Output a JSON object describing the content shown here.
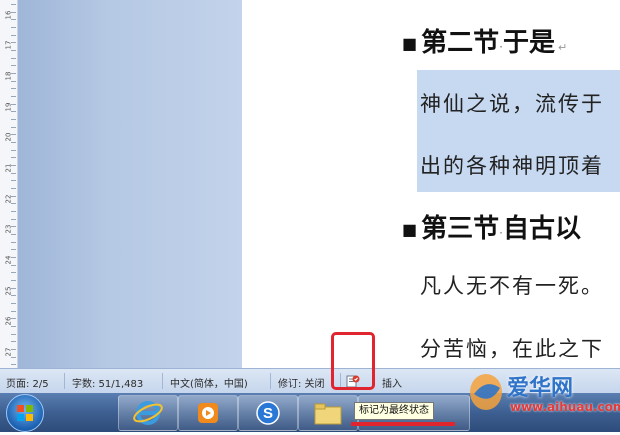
{
  "ruler": {
    "labels": [
      "16",
      "17",
      "18",
      "19",
      "20",
      "21",
      "22",
      "23",
      "24",
      "25",
      "26",
      "27"
    ]
  },
  "document": {
    "heading2": "第二节",
    "heading2_title": "于是",
    "line1": "神仙之说，流传于",
    "line2": "出的各种神明顶着",
    "heading3": "第三节",
    "heading3_title": "自古以",
    "line3": "凡人无不有一死。",
    "line4": "分苦恼，在此之下"
  },
  "statusbar": {
    "page": "页面: 2/5",
    "words": "字数: 51/1,483",
    "language": "中文(简体，中国)",
    "revision": "修订: 关闭",
    "insert": "插入"
  },
  "taskbar": {
    "tooltip": "标记为最终状态"
  },
  "watermark": {
    "text": "爱华网",
    "url": "www.aihuau.com"
  },
  "colors": {
    "annotation_red": "#e0252f",
    "selection": "#c6d9f1",
    "pane_blue": "#b5c8e4",
    "taskbar_blue": "#3d5f91"
  }
}
